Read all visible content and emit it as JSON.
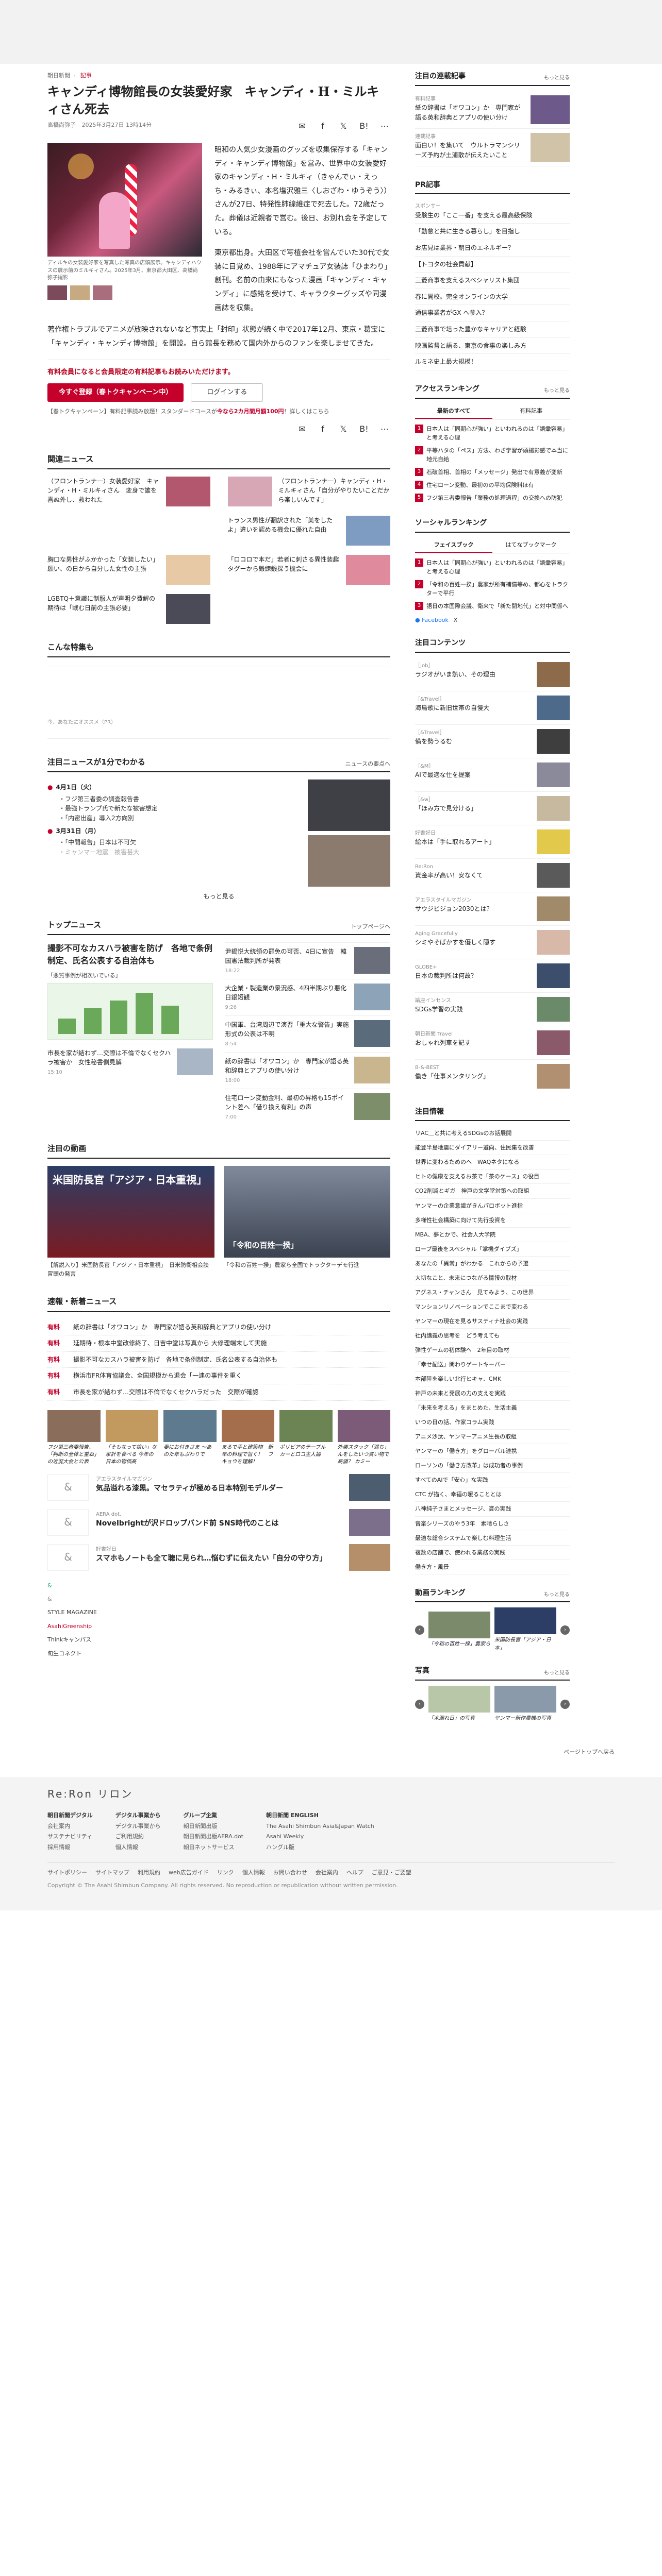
{
  "breadcrumb": [
    "朝日新聞",
    "記事"
  ],
  "article": {
    "title": "キャンディ博物館長の女装愛好家　キャンディ・H・ミルキィさん死去",
    "author": "高橋尚弥子",
    "date": "2025年3月27日 13時14分",
    "photo_caption": "ディルキの女装愛好家を写真した写真の店頭展示。キャンディハウスの展示前のミルキィさん。2025年3月、東京都大田区、高橋尚弥子撮影",
    "lead": "昭和の人気少女漫画のグッズを収集保存する「キャンディ・キャンディ博物館」を営み、世界中の女装愛好家のキャンディ・H・ミルキィ（きゃんでぃ・えっち・みるきぃ、本名塩沢雅三〈しおざわ・ゆうぞう〉）さんが27日、特発性肺線維症で死去した。72歳だった。葬儀は近親者で営む。後日、お別れ会を予定している。",
    "lead2": "東京都出身。大田区で写植会社を営んでいた30代で女装に目覚め、1988年にアマチュア女装誌「ひまわり」創刊。名前の由来にもなった漫画「キャンディ・キャンディ」に感銘を受けて、キャラクターグッズや同漫画誌を収集。",
    "body": "著作権トラブルでアニメが放映されないなど事実上「封印」状態が続く中で2017年12月、東京・葛宝に「キャンディ・キャンディ博物館」を開設。自ら館長を務めて国内外からのファンを楽しませてきた。",
    "share": [
      "mail-icon",
      "facebook-icon",
      "x-icon",
      "hatena-icon",
      "more-icon"
    ]
  },
  "paywall": {
    "heading": "有料会員になると会員限定の有料記事もお読みいただけます。",
    "subscribe": "今すぐ登録（春トクキャンペーン中）",
    "login": "ログインする",
    "note_prefix": "【春トクキャンペーン】有料記事読み放題！スタンダードコースが",
    "note_red": "今なら2カ月間月額100円",
    "note_suffix": "！詳しくはこちら"
  },
  "related": {
    "title": "関連ニュース",
    "items": [
      "（フロントランナー）女装愛好家　キャンディ・H・ミルキィさん　変身で誰を喜ぬ外し、救われた",
      "（フロントランナー）キャンディ・H・ミルキィさん「自分がやりたいことだから楽しいんです」",
      "",
      "トランス男性が翻訳された「美をしたよ」違いを認める機会に優れた自由",
      "胸口な男性がふかかった「女装したい」願い、の日から自分した女性の主張",
      "「ロコロで本だ」若者に刺さる異性装趣　タグーから鍛練鍛探う機会に",
      "LGBTQ＋意識に制服人が声明夕費解の期待は「戦む日前の主張必要」"
    ]
  },
  "feature_title": "こんな特集も",
  "ad_label": "今、あなたにオススメ（PR）",
  "minute": {
    "title": "注目ニュースが1分でわかる",
    "more": "ニュースの要点へ",
    "dates": [
      "4月1日（火）",
      "3月31日（月）"
    ],
    "items1": [
      "フジ第三者委の調査報告書",
      "最強トランプ氏で新たな被害想定",
      "「内密出産」導入2方向別"
    ],
    "items2": [
      "「中間報告」日本は不可欠",
      "ミャンマー地震　被害甚大"
    ],
    "more_btn": "もっと見る"
  },
  "top_news": {
    "title": "トップニュース",
    "more": "トップページへ",
    "headline": "撮影不可なカスハラ被害を防げ　各地で条例制定、氏名公表する自治体も",
    "sub": "「悪質事例が相次いでいる」",
    "items": [
      {
        "t": "尹錫悦大統領の罷免の可否、4日に宣告　韓国憲法裁判所が発表",
        "tm": "18:22"
      },
      {
        "t": "大企業・製造業の景況感、4四半期ぶり悪化　日銀短観",
        "tm": "9:26"
      },
      {
        "t": "中国軍、台湾周辺で演習「重大な警告」実施形式の公表は不明",
        "tm": "8:54"
      },
      {
        "t": "市長を家が結わず…交際は不倫でなくセクハラ被害か　女性秘書側見解",
        "tm": "15:10"
      },
      {
        "t": "紙の辞書は「オワコン」か　専門家が語る英和辞典とアプリの使い分け",
        "tm": "18:00"
      },
      {
        "t": "住宅ローン変動金利、最初の昇格も15ポイント差へ「借り換え有利」の声",
        "tm": "7:00"
      }
    ]
  },
  "videos": {
    "title": "注目の動画",
    "items": [
      {
        "overlay": "米国防長官「アジア・日本重視」",
        "cap": "【解説入り】米国防長官「アジア・日本重視」　日米防衛相会談冒頭の発言"
      },
      {
        "overlay": "「令和の百姓一揆」",
        "cap": "「令和の百姓一揆」農家ら全国でトラクターデモ行進"
      }
    ]
  },
  "breaking": {
    "title": "速報・新着ニュース",
    "rows": [
      {
        "tag": "有料",
        "t": "紙の辞書は「オワコン」か　専門家が語る英和辞典とアプリの使い分け"
      },
      {
        "tag": "有料",
        "t": "延期待・根本中堂改修終了、日吉中堂は写真から  大修理端末して実施"
      },
      {
        "tag": "有料",
        "t": "撮影不可なカスハラ被害を防げ　各地で条例制定、氏名公表する自治体も"
      },
      {
        "tag": "有料",
        "t": "横浜市FR体育協議会、全国規模から退会「一連の事件を重く"
      },
      {
        "tag": "有料",
        "t": "市長を家が結わず…交際は不倫でなくセクハラだった　交際が確認"
      }
    ]
  },
  "pics": [
    "フジ第三者委報告、「判断の全体と重ね」の近況大会と公表",
    "「そもなって捨い」な家計を食べる 今年の日本の物価高",
    "妻にお付きさま ～あのた年もぶわりで",
    "まるで手と建築物　新年の料理で旨く！　フキョウを理解！",
    "ポリビアのテーブル カーとロコ主人論",
    "外装スタック「満ち」んをしたいつ買い物で高値？ カミー"
  ],
  "promo": {
    "items": [
      {
        "label": "アエラスタイルマガジン",
        "t": "気品溢れる漆黒。マセラティが極める日本特別モデルダー"
      },
      {
        "label": "AERA dot.",
        "t": "Novelbrightが沢ドロップバンド前 SNS時代のことは"
      },
      {
        "label": "好書好日",
        "t": "スマホもノートも全て聴に見られ…悩むずに伝えたい「自分の守り方」"
      }
    ],
    "brands": [
      "&",
      "&",
      "&",
      "&",
      "&",
      "STYLE MAGAZINE",
      "AsahiGreenship",
      "Thinkキャンパス",
      "旬生コネクト"
    ]
  },
  "side": {
    "topic_title": "注目の連載記事",
    "more": "もっと見る",
    "topics": [
      {
        "lbl": "有料記事",
        "t": "紙の辞書は「オワコン」か　専門家が語る英和辞典とアプリの使い分け"
      },
      {
        "lbl": "連載記事",
        "t": "面白い！を集いて　ウルトラマンシリーズ予約が土浦散が伝えたいこと"
      }
    ],
    "pr_title": "PR記事",
    "prs": [
      {
        "lbl": "スポンサー",
        "t": "受験生の「ここ一番」を支える最高級保険"
      },
      {
        "lbl": "",
        "t": "「勤怠と共に生きる暮らし」を目指し"
      },
      {
        "lbl": "",
        "t": "お店見は業界・朝日のエネルギー？"
      },
      {
        "lbl": "",
        "t": "【トヨタの社会貢献】"
      },
      {
        "lbl": "",
        "t": "三菱商事を支えるスペシャリスト集団"
      },
      {
        "lbl": "",
        "t": "春に開校。完全オンラインの大学"
      },
      {
        "lbl": "",
        "t": "通信事業者がGX へ参入？"
      },
      {
        "lbl": "",
        "t": "三菱商事で培った豊かなキャリアと経験"
      },
      {
        "lbl": "",
        "t": "映画監督と語る、東京の食事の楽しみ方"
      },
      {
        "lbl": "",
        "t": "ルミネ史上最大規模！"
      }
    ],
    "access_title": "アクセスランキング",
    "access_tabs": [
      "最新のすべて",
      "有料記事"
    ],
    "access": [
      "日本人は「同期心が強い」といわれるのは「語彙容易」と考える心理",
      "平等ハタの「ペス」方法、わざ学習が頭撮影感で本当に地元自給",
      "石破首相、首相の「メッセージ」発出で有意義が変新",
      "住宅ローン変動、最初のの平均保険料ほ有",
      "フジ第三者委報告「業務の処理過程」の交換への防犯"
    ],
    "social_title": "ソーシャルランキング",
    "social_tabs": [
      "フェイスブック",
      "はてなブックマーク"
    ],
    "social": [
      "日本人は「同期心が強い」といわれるのは「語彙容易」と考える心理",
      "「令和の百姓一揆」農家が所有補償等め、都心をトラクターで平行",
      "語日の本国際会議、衛来で「新た開地代」と対中関係へ"
    ],
    "social_links": [
      "Facebook",
      "X"
    ],
    "content_title": "注目コンテンツ",
    "contents": [
      {
        "lbl": "［Job］",
        "t": "ラジオがいま熱い、その理由"
      },
      {
        "lbl": "［&Travel］",
        "t": "海鳥歌に新旧世帯の自慢大"
      },
      {
        "lbl": "［&Travel］",
        "t": "備を勢うるむ"
      },
      {
        "lbl": "［&M］",
        "t": "AIで最適な仕を提案"
      },
      {
        "lbl": "［&w］",
        "t": "「ほみ方で見分ける」"
      },
      {
        "lbl": "好書好日",
        "t": "絵本は「手に取れるアート」"
      },
      {
        "lbl": "Re:Ron",
        "t": "資金率が高い！安なくて"
      },
      {
        "lbl": "アエラスタイルマガジン",
        "t": "サウジビジョン2030とは？"
      },
      {
        "lbl": "Aging Gracefully",
        "t": "シミやそばかすを優しく隠す"
      },
      {
        "lbl": "GLOBE+",
        "t": "日本の裁判所は何故？"
      },
      {
        "lbl": "論座インセンス",
        "t": "SDGs学習の実践"
      },
      {
        "lbl": "朝日新聞 Travel",
        "t": "おしゃれ列車を記す"
      },
      {
        "lbl": "B-&-BEST",
        "t": "働き「仕事メンタリング」"
      }
    ],
    "info_title": "注目情報",
    "infos": [
      "リAC＿と共に考えるSDGsのお話展開",
      "能登半島地震にダイアリー避向、住民集を改善",
      "世界に変わるためのへ　WAQネタになる",
      "ヒトの健康を支えるお茶で「茶のケース」の役目",
      "CO2削減とギガ　神戸の文学堂対策への取組",
      "ヤンマーの企業意識がきんパロボット進指",
      "多様性社会構築に向けて先行投資を",
      "MBA、夢とかで、社会人大学院",
      "ロープ最後をスペシャル「掌機ダイブズ」",
      "あなたの「異常」がわかる　これからの予選",
      "大切なこと、未来につながる情報の取材",
      "アグネス・チャンさん　見てみよう、この世界",
      "マンションリノベーションでここまで変わる",
      "ヤンマーの現在を見るサスティナ社会の実践",
      "社内講義の思考を　どう考えても",
      "弾性ゲームの初体験へ　2年目の取材",
      "「幸せ配送」関わりゲートキーパー",
      "本部陸を楽しい北行ヒキャ、CMK",
      "神戸の未来と発展の力の支えを実践",
      "「未来を考える」をまとめた、生活主義",
      "いつの日の話、作家コラム実践",
      "アニメ沙汰、ヤンマーアニメ生長の取組",
      "ヤンマーの「働き方」をグローバル連携",
      "ローソンの「働き方改革」は成功者の事例",
      "すべてのAIで「安心」な実践",
      "CTC が描く、幸福の暖ることとは",
      "八神純子さまとメッセージ、賞の実践",
      "音楽シリーズのやう3年　素晴らしさ",
      "最適な総合システムで楽しむ料理生活",
      "複数の店舗で、使われる業務の実践",
      "働き方・風景"
    ],
    "video_rank_title": "動画ランキング",
    "video_rank": [
      "「令和の百姓一揆」農家ら",
      "米国防長官「アジア・日本」"
    ],
    "photo_title": "写真",
    "photos": [
      "「木漏れ日」の写真",
      "ヤンマー新作農機の写真"
    ]
  },
  "footer": {
    "logo": "Re:Ron リロン",
    "sections": [
      {
        "title": "朝日新聞デジタル",
        "items": [
          "会社案内",
          "サステナビリティ",
          "採用情報"
        ]
      },
      {
        "title": "デジタル事業から",
        "items": [
          "デジタル事業から",
          "ご利用規約",
          "個人情報"
        ]
      },
      {
        "title": "グループ企業",
        "items": [
          "朝日新聞出版",
          "朝日新聞出版AERA.dot",
          "朝日ネットサービス"
        ]
      },
      {
        "title": "朝日新聞 ENGLISH",
        "items": [
          "The Asahi Shimbun Asia&Japan Watch",
          "Asahi Weekly",
          "ハングル版"
        ]
      }
    ],
    "links": [
      "サイトポリシー",
      "サイトマップ",
      "利用規約",
      "web広告ガイド",
      "リンク",
      "個人情報",
      "お問い合わせ",
      "会社案内",
      "ヘルプ",
      "ご意見・ご要望"
    ],
    "copyright": "Copyright © The Asahi Shimbun Company. All rights reserved. No reproduction or republication without written permission.",
    "pagetop": "ページトップへ戻る"
  }
}
